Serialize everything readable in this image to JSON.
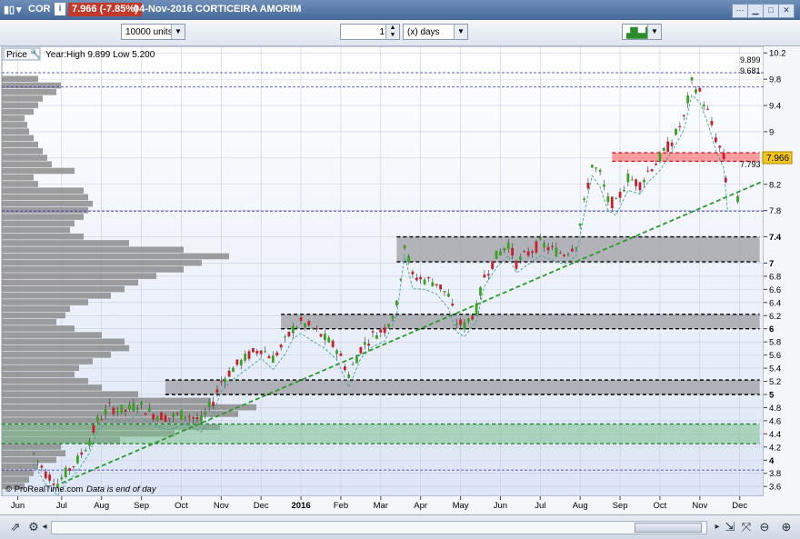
{
  "window": {
    "symbol": "COR",
    "price_change": "7.966 (-7.85%)",
    "title": "04-Nov-2016 CORTICEIRA AMORIM"
  },
  "toolbar": {
    "units_value": "10000 units",
    "period_value": "1",
    "period_unit": "(x) days"
  },
  "chart": {
    "price_label": "Price",
    "info_text": "Year:High 9.899 Low 5.200",
    "footer_source": "© ProRealTime.com",
    "footer_note": "Data is end of day",
    "current_price": "7.966",
    "level_high": "9.899",
    "level_mid": "9.681",
    "level_low": "7.793",
    "colors": {
      "up": "#3aa21e",
      "down": "#c8202a",
      "zone_grey": "#a3a3a8",
      "zone_green": "#7cc08e",
      "zone_red": "#ff6b6b",
      "trend": "#2b9a2b",
      "price_badge": "#f5c518"
    }
  },
  "chart_data": {
    "type": "candlestick",
    "y_ticks": [
      "10.2",
      "9.8",
      "9.4",
      "9",
      "8.6",
      "8.2",
      "7.8",
      "7.4",
      "7",
      "6.8",
      "6.6",
      "6.4",
      "6.2",
      "6",
      "5.8",
      "5.6",
      "5.4",
      "5.2",
      "5",
      "4.8",
      "4.6",
      "4.4",
      "4.2",
      "4",
      "3.8",
      "3.6"
    ],
    "ylim": [
      3.45,
      10.3
    ],
    "x_labels": [
      "Jun",
      "Jul",
      "Aug",
      "Sep",
      "Oct",
      "Nov",
      "Dec",
      "2016",
      "Feb",
      "Mar",
      "Apr",
      "May",
      "Jun",
      "Jul",
      "Aug",
      "Sep",
      "Oct",
      "Nov",
      "Dec"
    ],
    "x_positions": [
      0.9,
      2.0,
      3.0,
      4.0,
      5.0,
      6.0,
      7.0,
      8.0,
      9.0,
      10.0,
      11.0,
      12.0,
      13.0,
      14.0,
      15.0,
      16.0,
      17.0,
      18.0,
      19.0
    ],
    "x_range": [
      0.5,
      19.6
    ],
    "price_path": [
      [
        1.3,
        4.1
      ],
      [
        1.6,
        3.8
      ],
      [
        1.9,
        3.65
      ],
      [
        2.1,
        3.8
      ],
      [
        2.4,
        4.0
      ],
      [
        2.7,
        4.3
      ],
      [
        2.9,
        4.6
      ],
      [
        3.2,
        4.8
      ],
      [
        3.6,
        4.75
      ],
      [
        3.9,
        4.85
      ],
      [
        4.3,
        4.7
      ],
      [
        4.7,
        4.65
      ],
      [
        5.1,
        4.7
      ],
      [
        5.5,
        4.6
      ],
      [
        5.8,
        4.9
      ],
      [
        6.0,
        5.2
      ],
      [
        6.3,
        5.4
      ],
      [
        6.7,
        5.6
      ],
      [
        7.0,
        5.7
      ],
      [
        7.3,
        5.55
      ],
      [
        7.6,
        5.8
      ],
      [
        7.8,
        6.0
      ],
      [
        8.0,
        6.1
      ],
      [
        8.3,
        6.0
      ],
      [
        8.6,
        5.85
      ],
      [
        8.9,
        5.7
      ],
      [
        9.2,
        5.3
      ],
      [
        9.5,
        5.7
      ],
      [
        9.8,
        5.9
      ],
      [
        10.1,
        6.0
      ],
      [
        10.4,
        6.35
      ],
      [
        10.6,
        7.3
      ],
      [
        10.8,
        6.8
      ],
      [
        11.1,
        6.75
      ],
      [
        11.4,
        6.7
      ],
      [
        11.7,
        6.5
      ],
      [
        11.9,
        6.1
      ],
      [
        12.1,
        6.05
      ],
      [
        12.4,
        6.3
      ],
      [
        12.6,
        6.8
      ],
      [
        12.9,
        7.1
      ],
      [
        13.2,
        7.3
      ],
      [
        13.4,
        7.0
      ],
      [
        13.7,
        7.15
      ],
      [
        14.0,
        7.3
      ],
      [
        14.3,
        7.2
      ],
      [
        14.6,
        7.15
      ],
      [
        14.9,
        7.3
      ],
      [
        15.1,
        7.9
      ],
      [
        15.3,
        8.5
      ],
      [
        15.5,
        8.35
      ],
      [
        15.7,
        7.95
      ],
      [
        15.9,
        7.9
      ],
      [
        16.2,
        8.3
      ],
      [
        16.5,
        8.2
      ],
      [
        16.7,
        8.4
      ],
      [
        17.0,
        8.6
      ],
      [
        17.3,
        8.85
      ],
      [
        17.6,
        9.2
      ],
      [
        17.8,
        9.75
      ],
      [
        18.0,
        9.6
      ],
      [
        18.2,
        9.3
      ],
      [
        18.4,
        8.9
      ],
      [
        18.6,
        8.6
      ],
      [
        18.7,
        7.95
      ]
    ],
    "zones": [
      {
        "color": "grey",
        "y": [
          7.02,
          7.4
        ],
        "x": [
          10.4,
          19.5
        ]
      },
      {
        "color": "grey",
        "y": [
          6.0,
          6.22
        ],
        "x": [
          7.5,
          19.5
        ]
      },
      {
        "color": "grey",
        "y": [
          5.0,
          5.22
        ],
        "x": [
          4.6,
          19.5
        ]
      },
      {
        "color": "green",
        "y": [
          4.25,
          4.55
        ],
        "x": [
          0.5,
          19.5
        ]
      },
      {
        "color": "red",
        "y": [
          8.55,
          8.68
        ],
        "x": [
          15.8,
          19.5
        ]
      }
    ],
    "trendline": [
      [
        2.0,
        3.65
      ],
      [
        19.6,
        8.25
      ]
    ],
    "hlines": [
      9.899,
      9.681,
      7.793,
      3.85
    ],
    "volume_profile": [
      [
        3.6,
        25
      ],
      [
        3.7,
        30
      ],
      [
        3.8,
        35
      ],
      [
        3.9,
        40
      ],
      [
        4.0,
        60
      ],
      [
        4.1,
        70
      ],
      [
        4.2,
        65
      ],
      [
        4.3,
        130
      ],
      [
        4.4,
        190
      ],
      [
        4.5,
        240
      ],
      [
        4.6,
        220
      ],
      [
        4.7,
        260
      ],
      [
        4.8,
        280
      ],
      [
        4.9,
        230
      ],
      [
        5.0,
        150
      ],
      [
        5.1,
        110
      ],
      [
        5.2,
        95
      ],
      [
        5.3,
        80
      ],
      [
        5.4,
        85
      ],
      [
        5.5,
        100
      ],
      [
        5.6,
        120
      ],
      [
        5.7,
        140
      ],
      [
        5.8,
        135
      ],
      [
        5.9,
        110
      ],
      [
        6.0,
        80
      ],
      [
        6.1,
        60
      ],
      [
        6.2,
        70
      ],
      [
        6.3,
        75
      ],
      [
        6.4,
        95
      ],
      [
        6.5,
        120
      ],
      [
        6.6,
        135
      ],
      [
        6.7,
        150
      ],
      [
        6.8,
        170
      ],
      [
        6.9,
        200
      ],
      [
        7.0,
        220
      ],
      [
        7.1,
        250
      ],
      [
        7.2,
        200
      ],
      [
        7.3,
        140
      ],
      [
        7.4,
        90
      ],
      [
        7.5,
        75
      ],
      [
        7.6,
        80
      ],
      [
        7.7,
        90
      ],
      [
        7.8,
        95
      ],
      [
        7.9,
        100
      ],
      [
        8.0,
        95
      ],
      [
        8.1,
        90
      ],
      [
        8.2,
        40
      ],
      [
        8.3,
        35
      ],
      [
        8.4,
        80
      ],
      [
        8.5,
        55
      ],
      [
        8.6,
        50
      ],
      [
        8.7,
        45
      ],
      [
        8.8,
        40
      ],
      [
        8.9,
        35
      ],
      [
        9.0,
        30
      ],
      [
        9.1,
        28
      ],
      [
        9.2,
        25
      ],
      [
        9.3,
        35
      ],
      [
        9.4,
        40
      ],
      [
        9.5,
        45
      ],
      [
        9.6,
        60
      ],
      [
        9.7,
        65
      ],
      [
        9.8,
        40
      ]
    ]
  }
}
